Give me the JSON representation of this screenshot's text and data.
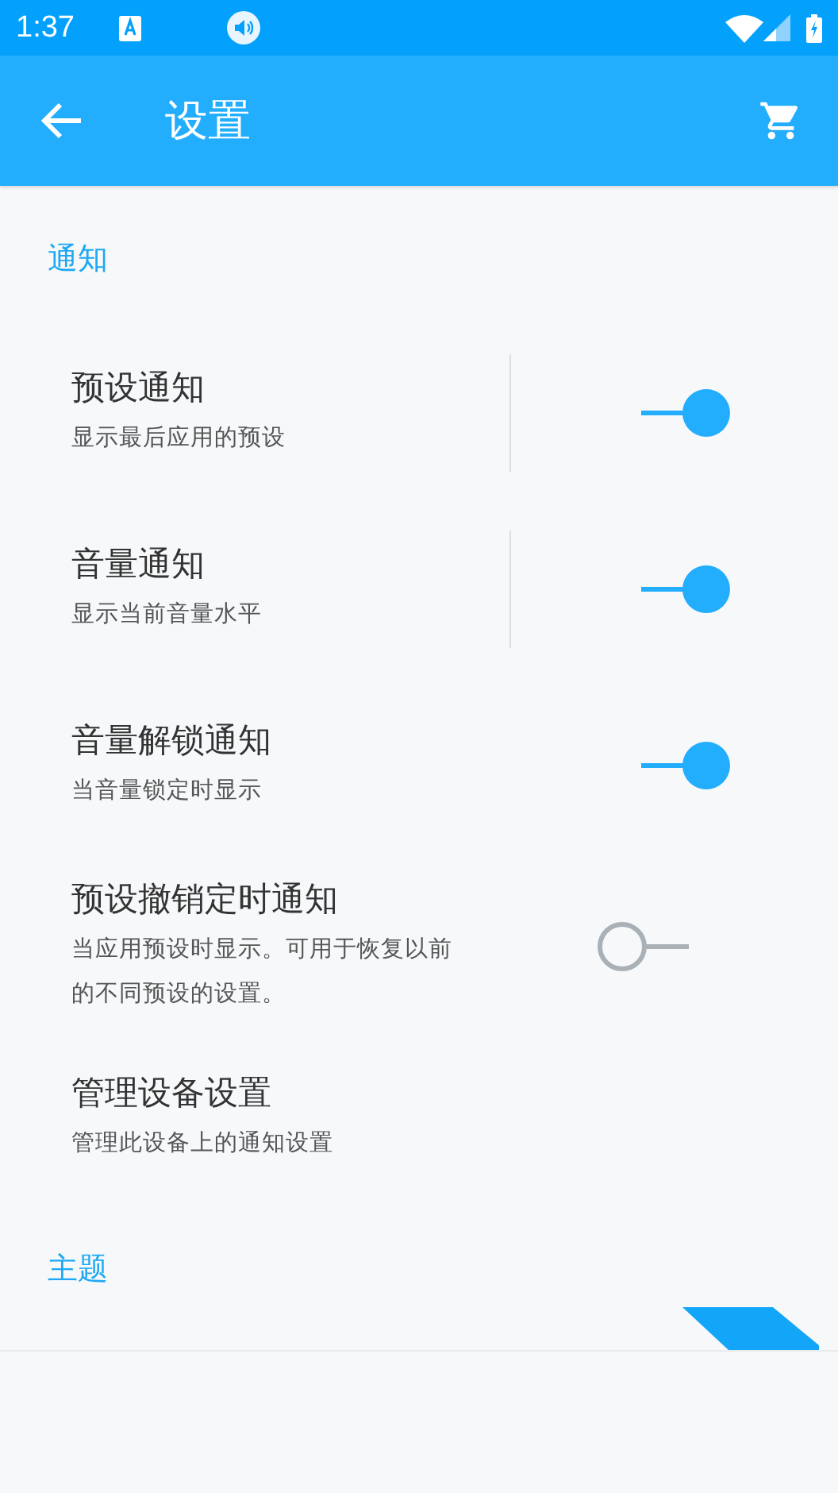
{
  "status_bar": {
    "time": "1:37"
  },
  "app_bar": {
    "title": "设置"
  },
  "sections": [
    {
      "header": "通知",
      "items": [
        {
          "title": "预设通知",
          "subtitle": "显示最后应用的预设",
          "on": true,
          "separator": true
        },
        {
          "title": "音量通知",
          "subtitle": "显示当前音量水平",
          "on": true,
          "separator": true
        },
        {
          "title": "音量解锁通知",
          "subtitle": "当音量锁定时显示",
          "on": true,
          "separator": false
        },
        {
          "title": "预设撤销定时通知",
          "subtitle": "当应用预设时显示。可用于恢复以前的不同预设的设置。",
          "on": false,
          "separator": false
        },
        {
          "title": "管理设备设置",
          "subtitle": "管理此设备上的通知设置",
          "kind": "link"
        }
      ]
    },
    {
      "header": "主题"
    }
  ]
}
